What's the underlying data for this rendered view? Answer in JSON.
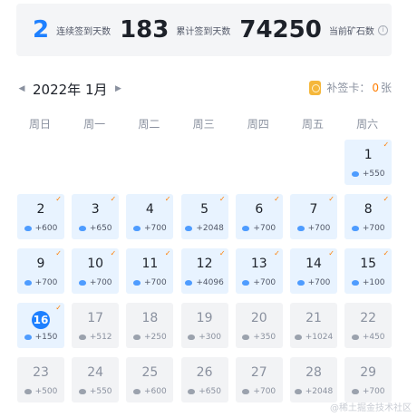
{
  "stats": {
    "consecutive_value": "2",
    "consecutive_label": "连续签到天数",
    "total_value": "183",
    "total_label": "累计签到天数",
    "ore_value": "74250",
    "ore_label": "当前矿石数",
    "info_glyph": "i"
  },
  "nav": {
    "prev_glyph": "◀",
    "month": "2022年 1月",
    "next_glyph": "▶"
  },
  "patch": {
    "label": "补签卡：",
    "count": "0",
    "unit": "张"
  },
  "weekdays": [
    "周日",
    "周一",
    "周二",
    "周三",
    "周四",
    "周五",
    "周六"
  ],
  "days": [
    {
      "day": "1",
      "ore": "+550",
      "status": "signed"
    },
    {
      "day": "2",
      "ore": "+600",
      "status": "signed"
    },
    {
      "day": "3",
      "ore": "+650",
      "status": "signed"
    },
    {
      "day": "4",
      "ore": "+700",
      "status": "signed"
    },
    {
      "day": "5",
      "ore": "+2048",
      "status": "signed"
    },
    {
      "day": "6",
      "ore": "+700",
      "status": "signed"
    },
    {
      "day": "7",
      "ore": "+700",
      "status": "signed"
    },
    {
      "day": "8",
      "ore": "+700",
      "status": "signed"
    },
    {
      "day": "9",
      "ore": "+700",
      "status": "signed"
    },
    {
      "day": "10",
      "ore": "+700",
      "status": "signed"
    },
    {
      "day": "11",
      "ore": "+700",
      "status": "signed"
    },
    {
      "day": "12",
      "ore": "+4096",
      "status": "signed"
    },
    {
      "day": "13",
      "ore": "+700",
      "status": "signed"
    },
    {
      "day": "14",
      "ore": "+700",
      "status": "signed"
    },
    {
      "day": "15",
      "ore": "+100",
      "status": "signed"
    },
    {
      "day": "16",
      "ore": "+150",
      "status": "today"
    },
    {
      "day": "17",
      "ore": "+512",
      "status": "future"
    },
    {
      "day": "18",
      "ore": "+250",
      "status": "future"
    },
    {
      "day": "19",
      "ore": "+300",
      "status": "future"
    },
    {
      "day": "20",
      "ore": "+350",
      "status": "future"
    },
    {
      "day": "21",
      "ore": "+1024",
      "status": "future"
    },
    {
      "day": "22",
      "ore": "+450",
      "status": "future"
    },
    {
      "day": "23",
      "ore": "+500",
      "status": "future"
    },
    {
      "day": "24",
      "ore": "+550",
      "status": "future"
    },
    {
      "day": "25",
      "ore": "+600",
      "status": "future"
    },
    {
      "day": "26",
      "ore": "+650",
      "status": "future"
    },
    {
      "day": "27",
      "ore": "+700",
      "status": "future"
    },
    {
      "day": "28",
      "ore": "+2048",
      "status": "future"
    },
    {
      "day": "29",
      "ore": "+700",
      "status": "future"
    }
  ],
  "check_glyph": "✓",
  "watermark": "@稀土掘金技术社区",
  "colors": {
    "accent": "#1e80ff",
    "signed_bg": "#e8f3ff",
    "future_bg": "#f2f3f5",
    "check": "#ff7d00"
  }
}
